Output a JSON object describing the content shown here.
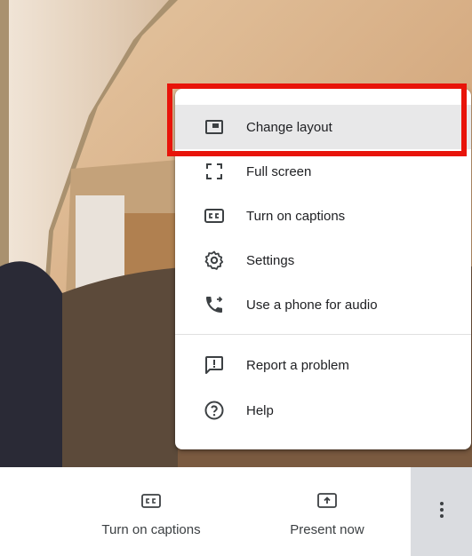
{
  "menu": {
    "items": [
      {
        "label": "Change layout",
        "icon": "change-layout-icon"
      },
      {
        "label": "Full screen",
        "icon": "full-screen-icon"
      },
      {
        "label": "Turn on captions",
        "icon": "captions-icon"
      },
      {
        "label": "Settings",
        "icon": "settings-icon"
      },
      {
        "label": "Use a phone for audio",
        "icon": "phone-audio-icon"
      },
      {
        "label": "Report a problem",
        "icon": "report-problem-icon"
      },
      {
        "label": "Help",
        "icon": "help-icon"
      }
    ],
    "highlighted_item": "Change layout"
  },
  "bottom_bar": {
    "captions_label": "Turn on captions",
    "present_label": "Present now",
    "more_icon": "more-vert-icon"
  },
  "colors": {
    "highlight_box": "#e8140a",
    "menu_hover": "#e8e8e9",
    "text": "#202124"
  }
}
